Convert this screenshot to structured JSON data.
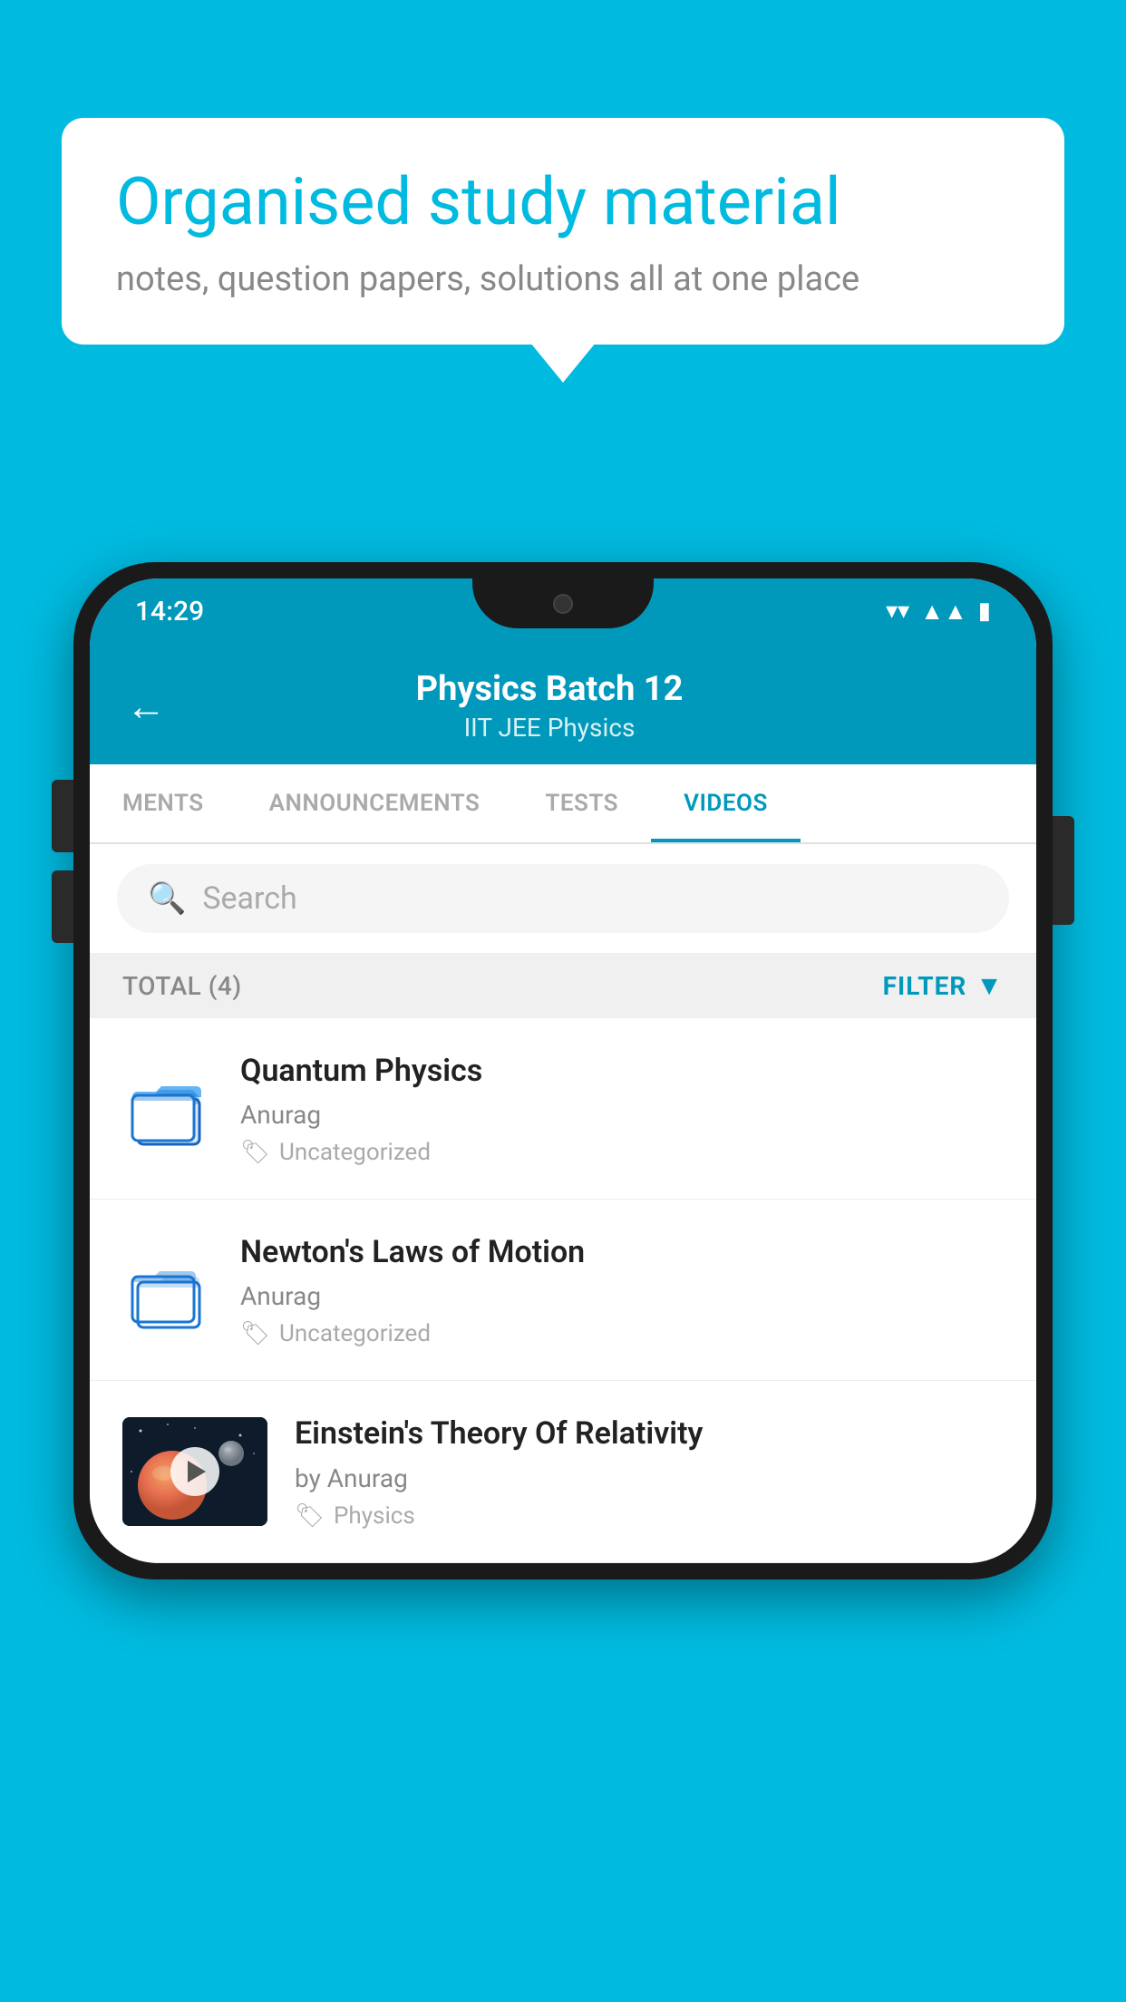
{
  "background_color": "#00BADF",
  "speech_bubble": {
    "title": "Organised study material",
    "subtitle": "notes, question papers, solutions all at one place"
  },
  "phone": {
    "status_bar": {
      "time": "14:29"
    },
    "header": {
      "title": "Physics Batch 12",
      "subtitle": "IIT JEE   Physics",
      "back_label": "←"
    },
    "tabs": [
      {
        "label": "MENTS",
        "active": false
      },
      {
        "label": "ANNOUNCEMENTS",
        "active": false
      },
      {
        "label": "TESTS",
        "active": false
      },
      {
        "label": "VIDEOS",
        "active": true
      }
    ],
    "search": {
      "placeholder": "Search"
    },
    "filter_bar": {
      "total_label": "TOTAL (4)",
      "filter_label": "FILTER"
    },
    "video_list": [
      {
        "id": 1,
        "title": "Quantum Physics",
        "author": "Anurag",
        "tag": "Uncategorized",
        "has_thumbnail": false
      },
      {
        "id": 2,
        "title": "Newton's Laws of Motion",
        "author": "Anurag",
        "tag": "Uncategorized",
        "has_thumbnail": false
      },
      {
        "id": 3,
        "title": "Einstein's Theory Of Relativity",
        "author": "by Anurag",
        "tag": "Physics",
        "has_thumbnail": true
      }
    ]
  }
}
